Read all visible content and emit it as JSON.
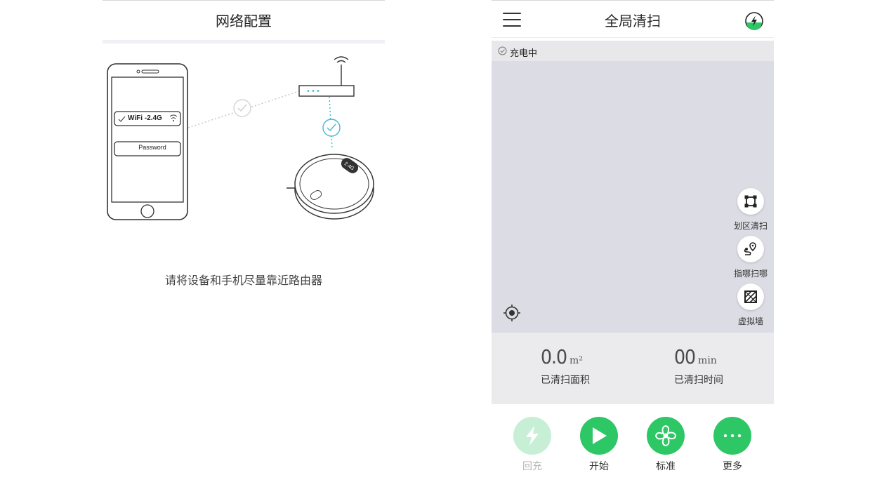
{
  "network_config": {
    "title": "网络配置",
    "wifi_label": "WiFi -2.4G",
    "password_label": "Password",
    "robot_badge_text": "2.4G",
    "instruction": "请将设备和手机尽量靠近路由器"
  },
  "robot_app": {
    "title": "全局清扫",
    "status_text": "充电中",
    "side_tools": [
      {
        "label": "划区清扫",
        "icon": "zone-clean-icon"
      },
      {
        "label": "指哪扫哪",
        "icon": "spot-clean-icon"
      },
      {
        "label": "虚拟墙",
        "icon": "virtual-wall-icon"
      }
    ],
    "stats": {
      "area_value": "0.0",
      "area_unit": "m²",
      "area_caption": "已清扫面积",
      "time_value": "00",
      "time_unit": "min",
      "time_caption": "已清扫时间"
    },
    "actions": [
      {
        "label": "回充",
        "icon": "recharge-icon",
        "enabled": false
      },
      {
        "label": "开始",
        "icon": "play-icon",
        "enabled": true
      },
      {
        "label": "标准",
        "icon": "fan-icon",
        "enabled": true
      },
      {
        "label": "更多",
        "icon": "more-icon",
        "enabled": true
      }
    ],
    "colors": {
      "accent_green": "#2ec766",
      "disabled_green": "#c6efd6",
      "map_background": "#dcdde4"
    }
  }
}
